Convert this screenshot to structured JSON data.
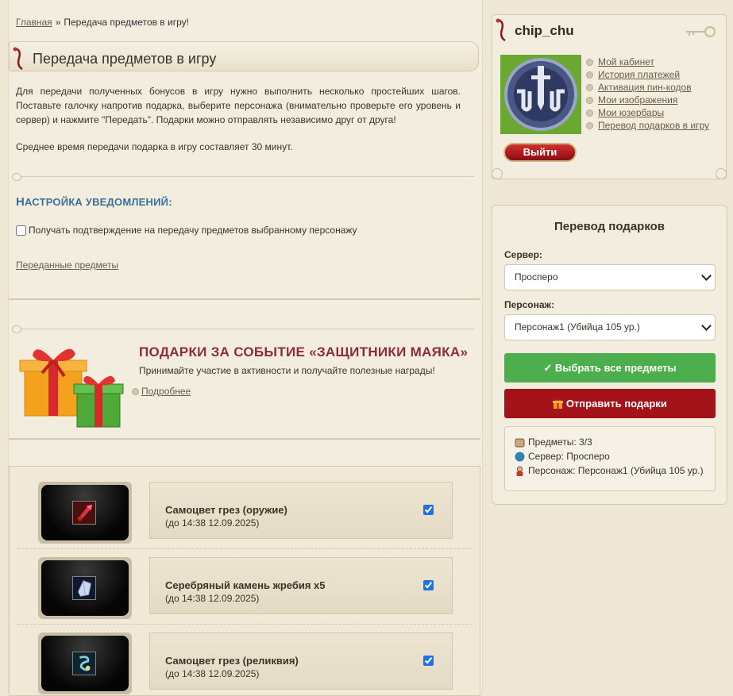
{
  "breadcrumb": {
    "home": "Главная",
    "sep": "»",
    "current": "Передача предметов в игру!"
  },
  "page_title": "Передача предметов в игру",
  "intro": {
    "p1": "Для передачи полученных бонусов в игру нужно выполнить несколько простейших шагов. Поставьте галочку напротив подарка, выберите персонажа (внимательно проверьте его уровень и сервер) и нажмите \"Передать\". Подарки можно отправлять независимо друг от друга!",
    "p2": "Среднее время передачи подарка в игру составляет 30 минут."
  },
  "notifications": {
    "heading_first": "Н",
    "heading_rest": "АСТРОЙКА УВЕДОМЛЕНИЙ:",
    "checkbox_label": "Получать подтверждение на передачу предметов выбранному персонажу",
    "checked": false,
    "transferred_link": "Переданные предметы"
  },
  "event": {
    "title": "ПОДАРКИ ЗА СОБЫТИЕ «ЗАЩИТНИКИ МАЯКА»",
    "text": "Принимайте участие в активности и получайте полезные награды!",
    "more": "Подробнее"
  },
  "items": [
    {
      "name": "Самоцвет грез (оружие)",
      "date": "(до 14:38 12.09.2025)",
      "checked": true,
      "icon": "red-gem-icon"
    },
    {
      "name": "Серебряный камень жребия x5",
      "date": "(до 14:38 12.09.2025)",
      "checked": true,
      "icon": "silver-stone-icon"
    },
    {
      "name": "Самоцвет грез (реликвия)",
      "date": "(до 14:38 12.09.2025)",
      "checked": true,
      "icon": "relic-gem-icon"
    }
  ],
  "user": {
    "username": "chip_chu",
    "menu": [
      "Мой кабинет",
      "История платежей",
      "Активация пин-кодов",
      "Мои изображения",
      "Мои юзербары",
      "Перевод подарков в игру"
    ],
    "logout": "Выйти"
  },
  "transfer": {
    "title": "Перевод подарков",
    "server_label": "Сервер:",
    "server_value": "Просперо",
    "character_label": "Персонаж:",
    "character_value": "Персонаж1 (Убийца 105 ур.)",
    "select_all": "✓ Выбрать все предметы",
    "send": "Отправить подарки",
    "summary": {
      "items": "Предметы: 3/3",
      "server": "Сервер: Просперо",
      "character": "Персонаж: Персонаж1 (Убийца 105 ур.)"
    }
  },
  "colors": {
    "accent_blue": "#3d6f9c",
    "event_title": "#8e2a3c",
    "green_button": "#4cae4c",
    "red_button": "#a4131a"
  }
}
